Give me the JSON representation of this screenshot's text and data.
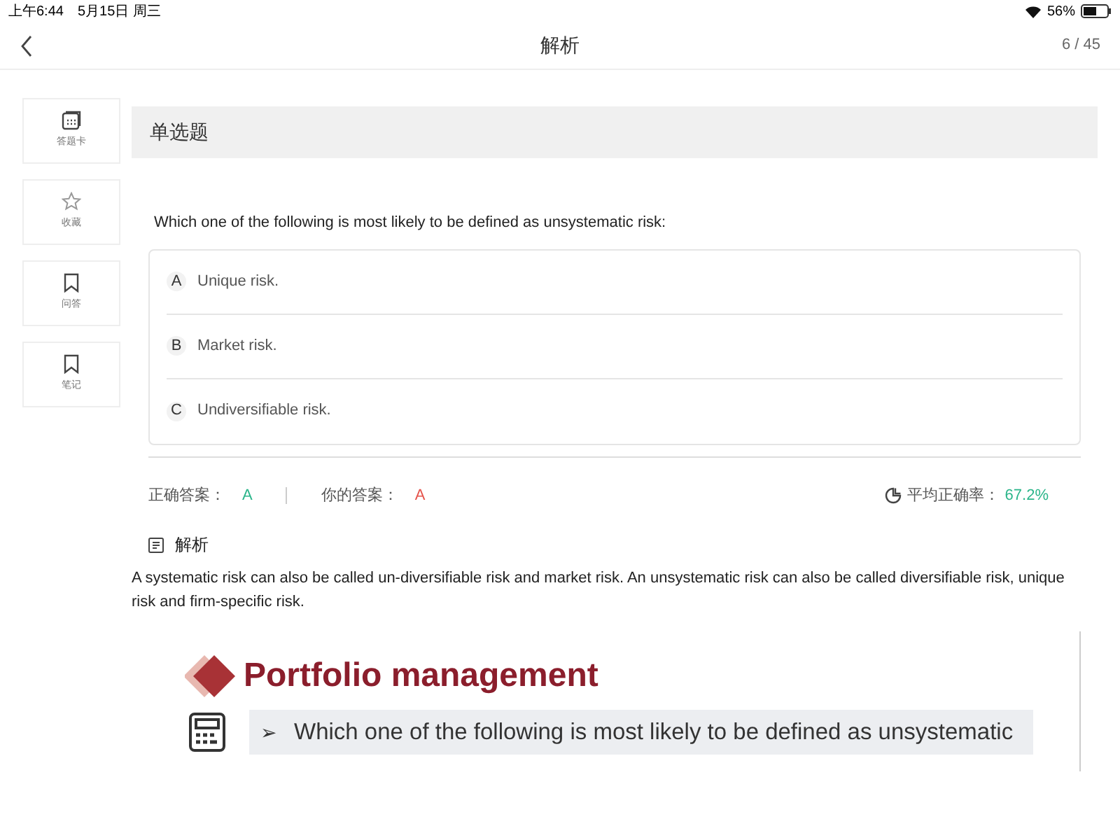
{
  "status_bar": {
    "time": "上午6:44",
    "date": "5月15日 周三",
    "battery": "56%"
  },
  "nav": {
    "title": "解析",
    "progress": "6 / 45"
  },
  "sidebar": {
    "items": [
      {
        "kind": "grid",
        "label": "答题卡"
      },
      {
        "kind": "star",
        "label": "收藏"
      },
      {
        "kind": "bookmark",
        "label": "问答"
      },
      {
        "kind": "bookmark",
        "label": "笔记"
      }
    ]
  },
  "question": {
    "type": "单选题",
    "text": "Which one of the following is most likely to be defined as unsystematic risk:",
    "options": [
      {
        "letter": "A",
        "text": "Unique risk."
      },
      {
        "letter": "B",
        "text": "Market risk."
      },
      {
        "letter": "C",
        "text": "Undiversifiable risk."
      }
    ]
  },
  "answers": [
    {
      "label": "正确答案：",
      "value": "A",
      "color": "#2bb58a"
    },
    {
      "label": "你的答案：",
      "value": "A",
      "color": "#e5534b"
    }
  ],
  "accuracy": {
    "label": "平均正确率：",
    "value": "67.2%"
  },
  "analysis": {
    "heading": "解析",
    "text": "A systematic risk can also be called un-diversifiable risk and market risk. An unsystematic risk can also be called diversifiable risk, unique risk and firm-specific risk.",
    "slide": {
      "title": "Portfolio management",
      "bullet": "➢",
      "line": "Which one of the following is most likely to be defined as unsystematic"
    }
  }
}
